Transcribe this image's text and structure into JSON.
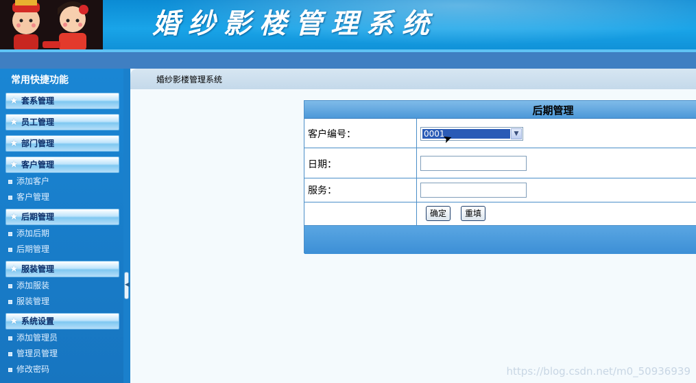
{
  "header": {
    "title": "婚纱影楼管理系统",
    "logo_icon": "couple-cartoon-logo"
  },
  "sidebar": {
    "heading": "常用快捷功能",
    "groups": [
      {
        "label": "套系管理",
        "items": []
      },
      {
        "label": "员工管理",
        "items": []
      },
      {
        "label": "部门管理",
        "items": []
      },
      {
        "label": "客户管理",
        "items": [
          "添加客户",
          "客户管理"
        ]
      },
      {
        "label": "后期管理",
        "items": [
          "添加后期",
          "后期管理"
        ]
      },
      {
        "label": "服装管理",
        "items": [
          "添加服装",
          "服装管理"
        ]
      },
      {
        "label": "系统设置",
        "items": [
          "添加管理员",
          "管理员管理",
          "修改密码"
        ]
      }
    ]
  },
  "breadcrumb": "婚纱影楼管理系统",
  "form": {
    "title": "后期管理",
    "customer_id_label": "客户编号：",
    "customer_id_value": "0001",
    "date_label": "日期：",
    "date_value": "",
    "service_label": "服务：",
    "service_value": "",
    "submit_label": "确定",
    "reset_label": "重填"
  },
  "watermark": "https://blog.csdn.net/m0_50936939"
}
